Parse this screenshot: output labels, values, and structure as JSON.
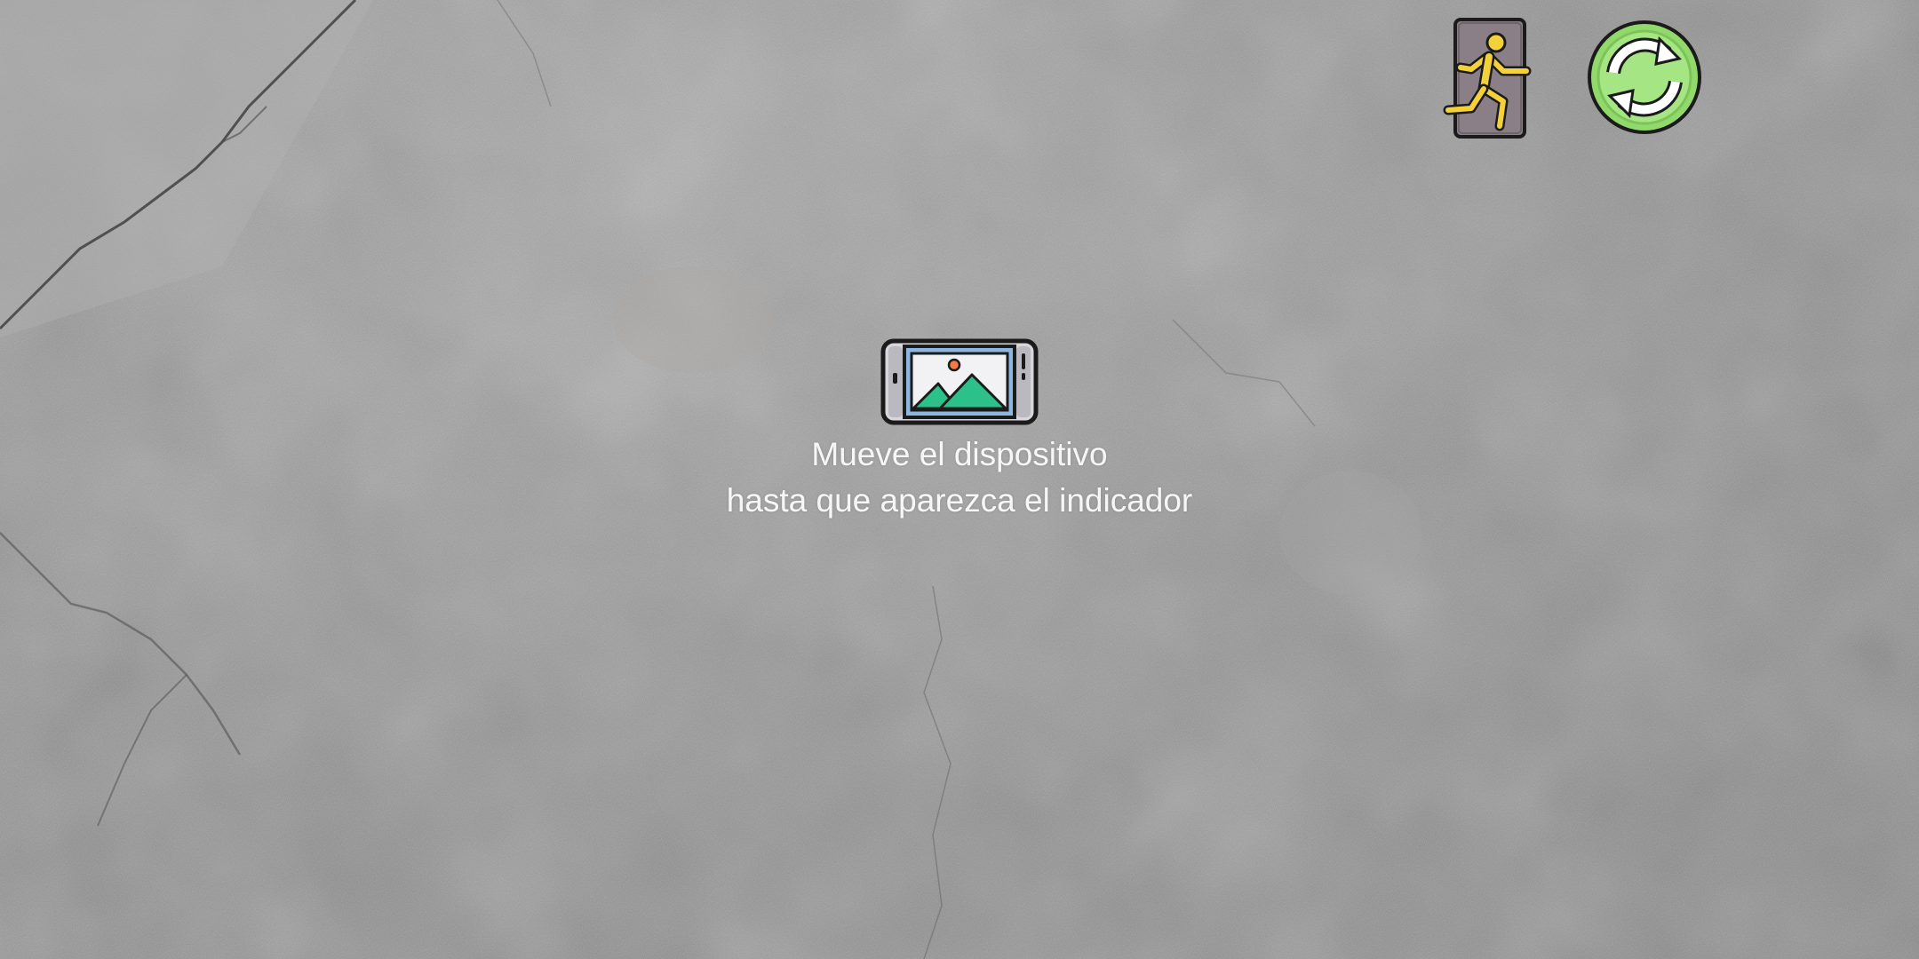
{
  "screen": {
    "hint": {
      "icon": "phone-landscape-image-icon",
      "line1": "Mueve el dispositivo",
      "line2": "hasta que aparezca el indicador"
    },
    "toolbar": {
      "exit_icon": "emergency-exit-icon",
      "refresh_icon": "refresh-icon"
    }
  },
  "colors": {
    "exit_door": "#8a7f86",
    "exit_runner": "#f2d13a",
    "refresh_ring": "#90d96a",
    "refresh_arrows": "#ffffff",
    "phone_body": "#d7d7db",
    "screen_frame": "#8bb7e0",
    "mountain": "#2cc08a"
  }
}
